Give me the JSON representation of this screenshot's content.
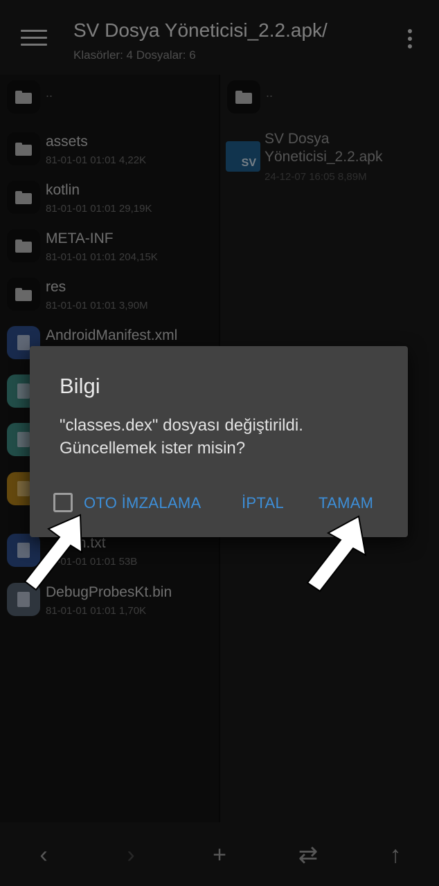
{
  "appbar": {
    "title": "SV Dosya Yöneticisi_2.2.apk/",
    "subtitle": "Klasörler: 4  Dosyalar: 6"
  },
  "left_pane": {
    "parent": "..",
    "items": [
      {
        "name": "assets",
        "meta": "81-01-01 01:01  4,22K",
        "icon": "folder-icon"
      },
      {
        "name": "kotlin",
        "meta": "81-01-01 01:01  29,19K",
        "icon": "folder-icon"
      },
      {
        "name": "META-INF",
        "meta": "81-01-01 01:01  204,15K",
        "icon": "folder-icon"
      },
      {
        "name": "res",
        "meta": "81-01-01 01:01  3,90M",
        "icon": "folder-icon"
      },
      {
        "name": "AndroidManifest.xml",
        "meta": "",
        "icon": "xml-file-icon"
      },
      {
        "name": "",
        "meta": "",
        "icon": "binary-file-icon"
      },
      {
        "name": "",
        "meta": "",
        "icon": "binary-file-icon"
      },
      {
        "name": "",
        "meta": "",
        "icon": "layers-icon"
      },
      {
        "name": "sion.txt",
        "meta": "1-01-01 01:01  53B",
        "icon": "text-file-icon"
      },
      {
        "name": "DebugProbesKt.bin",
        "meta": "81-01-01 01:01  1,70K",
        "icon": "file-icon"
      }
    ]
  },
  "right_pane": {
    "parent": "..",
    "apk": {
      "badge": "SV",
      "name": "SV Dosya Yöneticisi_2.2.apk",
      "meta": "24-12-07 16:05  8,89M"
    }
  },
  "dialog": {
    "title": "Bilgi",
    "message": "\"classes.dex\" dosyası değiştirildi. Güncellemek ister misin?",
    "auto_sign_label": "OTO İMZALAMA",
    "cancel_label": "İPTAL",
    "ok_label": "TAMAM",
    "auto_sign_checked": false,
    "accent_color": "#3d8fd9"
  },
  "bottombar": {
    "back": "‹",
    "forward": "›",
    "add": "+",
    "swap": "⇄",
    "up": "↑"
  }
}
